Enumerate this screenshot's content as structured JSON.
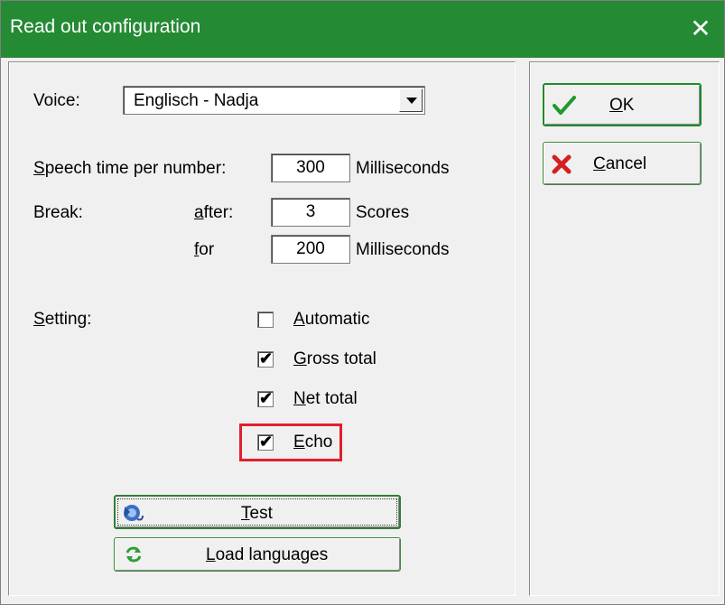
{
  "window": {
    "title": "Read out configuration",
    "close_glyph": "✕",
    "accent": "#258a34"
  },
  "voice": {
    "label": "Voice:",
    "selected": "Englisch - Nadja"
  },
  "speech": {
    "label_prefix": "S",
    "label_rest": "peech time per number:",
    "value": "300",
    "unit": "Milliseconds"
  },
  "break": {
    "label": "Break:",
    "after_u": "a",
    "after_rest": "fter:",
    "after_value": "3",
    "after_unit": "Scores",
    "for_u": "f",
    "for_rest": "or",
    "for_value": "200",
    "for_unit": "Milliseconds"
  },
  "setting": {
    "label_u": "S",
    "label_rest": "etting:",
    "options": [
      {
        "u": "A",
        "rest": "utomatic",
        "checked": false
      },
      {
        "u": "G",
        "rest": "ross total",
        "checked": true
      },
      {
        "u": "N",
        "rest": "et total",
        "checked": true
      },
      {
        "u": "E",
        "rest": "cho",
        "checked": true
      }
    ]
  },
  "buttons": {
    "ok_u": "O",
    "ok_rest": "K",
    "ok_icon": "checkmark-icon",
    "cancel_u": "C",
    "cancel_rest": "ancel",
    "cancel_icon": "red-x-icon",
    "test_u": "T",
    "test_rest": "est",
    "test_icon": "speaker-icon",
    "load_u": "L",
    "load_rest": "oad languages",
    "load_icon": "refresh-icon"
  },
  "check_glyph": "✔"
}
